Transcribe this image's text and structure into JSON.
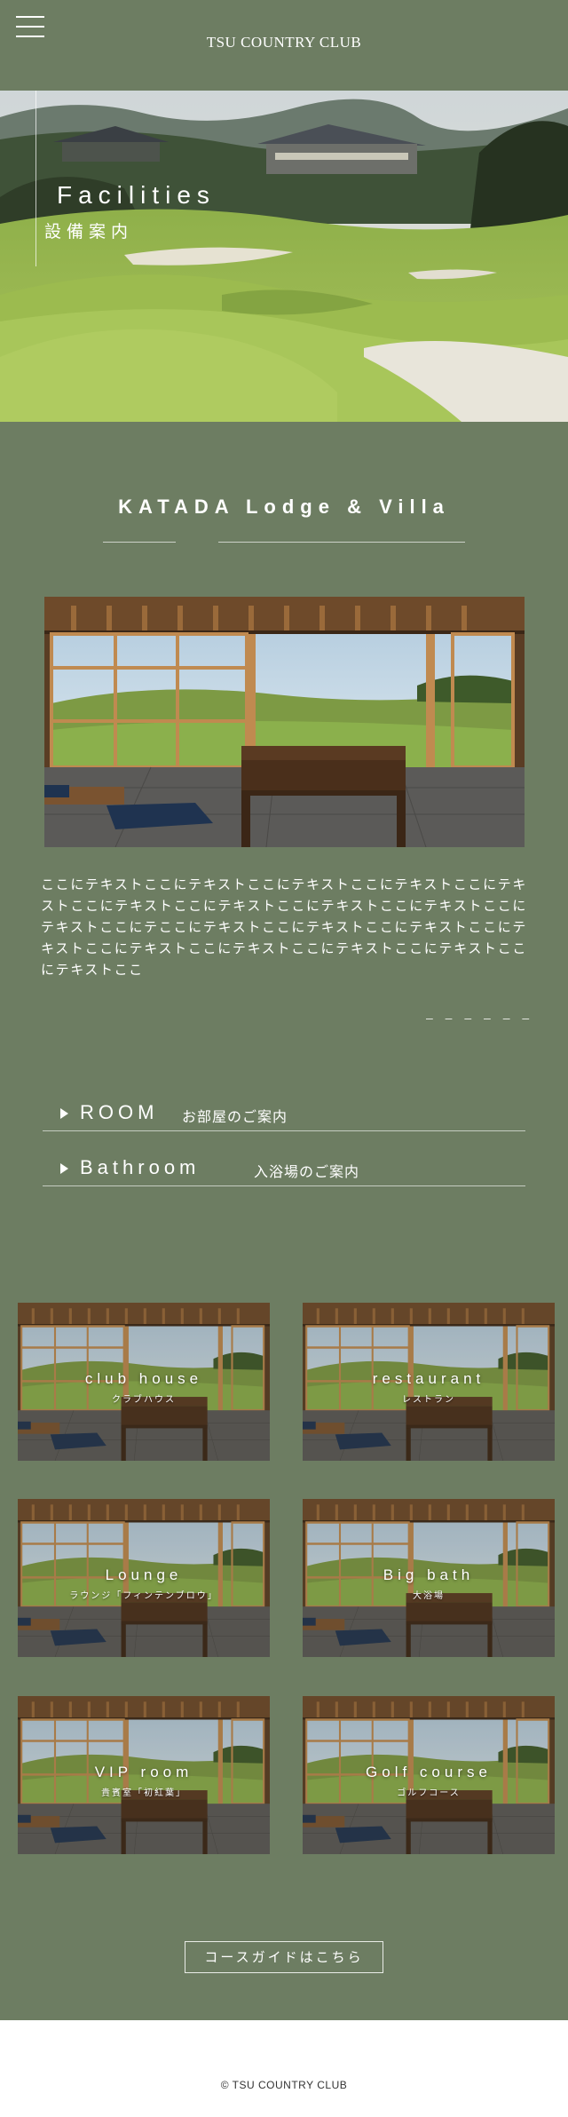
{
  "header": {
    "menu_icon": "hamburger-menu-icon",
    "site_title": "TSU COUNTRY CLUB"
  },
  "hero": {
    "title": "Facilities",
    "subtitle": "設備案内"
  },
  "lodge": {
    "heading": "KATADA Lodge & Villa",
    "body": "ここにテキストここにテキストここにテキストここにテキストここにテキストここにテキストここにテキストここにテキストここにテキストここにテキストここにテここにテキストここにテキストここにテキストここにテキストここにテキストここにテキストここにテキストここにテキストここにテキストここ",
    "dashes": "– – – – – –"
  },
  "links": [
    {
      "en": "ROOM",
      "ja": "お部屋のご案内",
      "icon": "triangle-right-icon"
    },
    {
      "en": "Bathroom",
      "ja": "入浴場のご案内",
      "icon": "triangle-right-icon"
    }
  ],
  "tiles": [
    {
      "en": "club house",
      "ja": "クラブハウス"
    },
    {
      "en": "restaurant",
      "ja": "レストラン"
    },
    {
      "en": "Lounge",
      "ja": "ラウンジ「フィンテンブロウ」"
    },
    {
      "en": "Big bath",
      "ja": "大浴場"
    },
    {
      "en": "VIP room",
      "ja": "貴賓室「初紅葉」"
    },
    {
      "en": "Golf course",
      "ja": "ゴルフコース"
    }
  ],
  "guide_button": "コースガイドはこちら",
  "footer": {
    "copyright": "© TSU COUNTRY CLUB"
  },
  "colors": {
    "background": "#6d7d62",
    "footer_background": "#ffffff",
    "text": "#ffffff"
  }
}
